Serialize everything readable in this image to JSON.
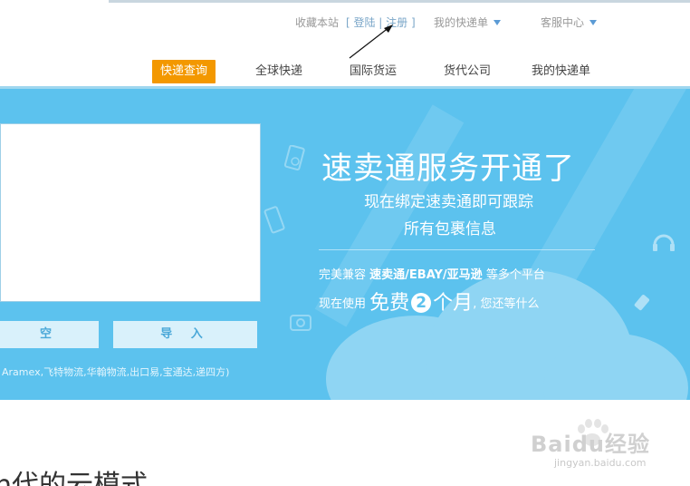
{
  "top_links": {
    "favorite": "收藏本站",
    "login_register": "[ 登陆 | 注册 ]",
    "my_orders": "我的快递单",
    "service_center": "客服中心"
  },
  "nav": [
    {
      "label": "快递查询",
      "active": true
    },
    {
      "label": "全球快递"
    },
    {
      "label": "国际货运"
    },
    {
      "label": "货代公司"
    },
    {
      "label": "我的快递单"
    }
  ],
  "query": {
    "clear_button": "空",
    "import_button": "导 入",
    "carriers_note": "Aramex,飞特物流,华翰物流,出口易,宝通达,递四方)"
  },
  "promo": {
    "title": "速卖通服务开通了",
    "line1": "现在绑定速卖通即可跟踪",
    "line2": "所有包裹信息",
    "compat_prefix": "完美兼容",
    "compat_platforms": "速卖通/EBAY/亚马逊",
    "compat_suffix": "等多个平台",
    "use_prefix": "现在使用",
    "use_free": "免费",
    "use_number": "2",
    "use_unit": "个月",
    "use_suffix": ", 您还等什么"
  },
  "bottom": {
    "heading": "η代的云模式"
  },
  "watermark": {
    "brand": "Baidu经验",
    "site": "jingyan.baidu.com"
  },
  "colors": {
    "accent": "#f39800",
    "banner": "#5cc2ee",
    "link": "#5b9bd5"
  }
}
